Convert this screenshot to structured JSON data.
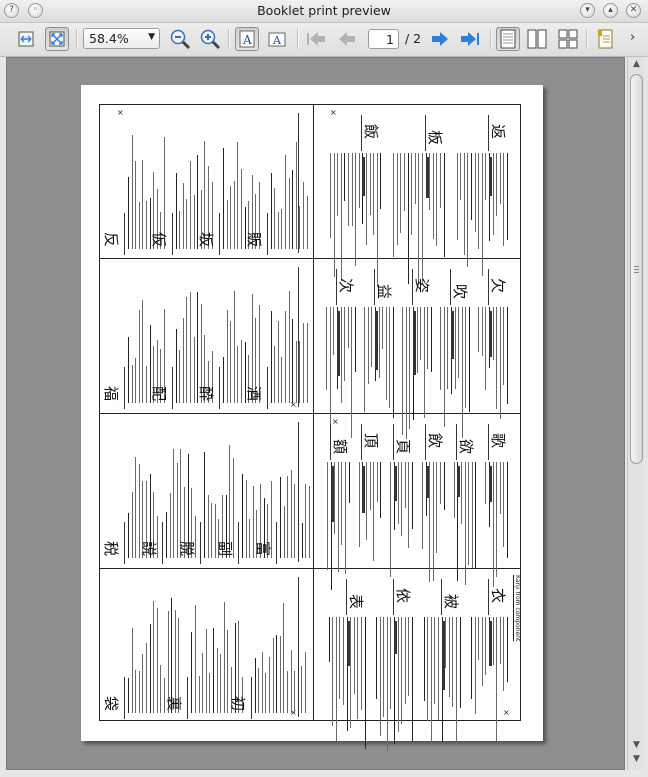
{
  "window": {
    "title": "Booklet print preview",
    "buttons": [
      "help",
      "minimize",
      "maximize",
      "close"
    ]
  },
  "toolbar": {
    "zoom_value": "58.4%",
    "page_current": "1",
    "page_separator_total": "/ 2",
    "overflow_label": "›"
  },
  "colors": {
    "accent_blue": "#2f7fd8",
    "disabled_gray": "#aeb3b8",
    "viewport_bg": "#8f8f8f"
  },
  "sheet": {
    "top_row_kanji": [
      "返",
      "板",
      "飯",
      "欠",
      "吹",
      "姿",
      "益",
      "次",
      "歌",
      "欲",
      "飲",
      "頁",
      "頂",
      "額",
      "衣",
      "被",
      "依",
      "表"
    ],
    "bottom_row_kanji": [
      "反",
      "仮",
      "坂",
      "販",
      "福",
      "配",
      "酔",
      "酒",
      "税",
      "説",
      "脱",
      "副",
      "富",
      "袋",
      "裏",
      "初"
    ],
    "header_link": "Kanji from component"
  }
}
